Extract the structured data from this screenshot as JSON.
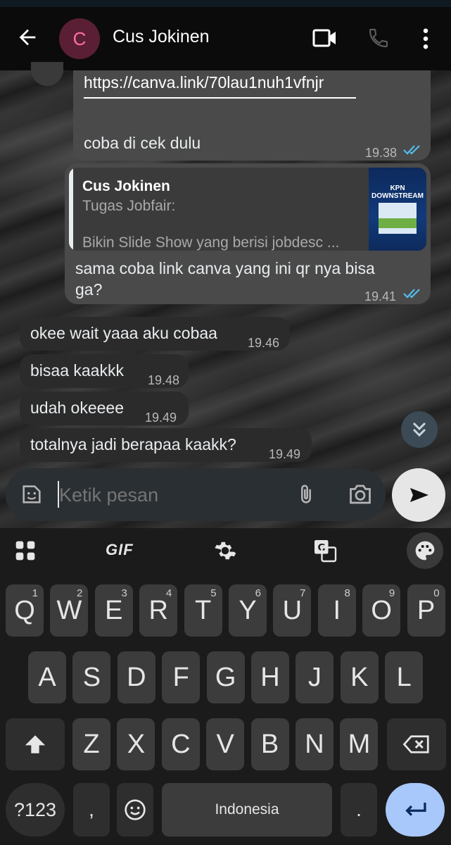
{
  "header": {
    "contact_name": "Cus Jokinen",
    "avatar_letter": "C"
  },
  "messages": {
    "m1": {
      "link": "https://canva.link/70lau1nuh1vfnjr",
      "text": "coba di cek dulu",
      "time": "19.38"
    },
    "m2": {
      "quote_author": "Cus Jokinen",
      "quote_line1": "Tugas Jobfair:",
      "quote_line2": "Bikin Slide Show yang berisi jobdesc ...",
      "thumb_title1": "KPN",
      "thumb_title2": "DOWNSTREAM",
      "text1": "sama coba link canva yang ini qr nya bisa",
      "text2": "ga?",
      "time": "19.41"
    },
    "m3": {
      "text": "okee wait yaaa aku cobaa",
      "time": "19.46"
    },
    "m4": {
      "text": "bisaa kaakkk",
      "time": "19.48"
    },
    "m5": {
      "text": "udah okeeee",
      "time": "19.49"
    },
    "m6": {
      "text": "totalnya jadi berapaa kaakk?",
      "time": "19.49"
    }
  },
  "composer": {
    "placeholder": "Ketik pesan"
  },
  "keyboard": {
    "toolbar": {
      "gif": "GIF"
    },
    "row1": [
      {
        "k": "Q",
        "n": "1"
      },
      {
        "k": "W",
        "n": "2"
      },
      {
        "k": "E",
        "n": "3"
      },
      {
        "k": "R",
        "n": "4"
      },
      {
        "k": "T",
        "n": "5"
      },
      {
        "k": "Y",
        "n": "6"
      },
      {
        "k": "U",
        "n": "7"
      },
      {
        "k": "I",
        "n": "8"
      },
      {
        "k": "O",
        "n": "9"
      },
      {
        "k": "P",
        "n": "0"
      }
    ],
    "row2": [
      "A",
      "S",
      "D",
      "F",
      "G",
      "H",
      "J",
      "K",
      "L"
    ],
    "row3": [
      "Z",
      "X",
      "C",
      "V",
      "B",
      "N",
      "M"
    ],
    "symbols": "?123",
    "comma": ",",
    "space": "Indonesia",
    "period": "."
  },
  "colors": {
    "tick": "#53bdeb",
    "send_bg": "#e6e6e6",
    "accent_enter": "#a8c7fa"
  }
}
